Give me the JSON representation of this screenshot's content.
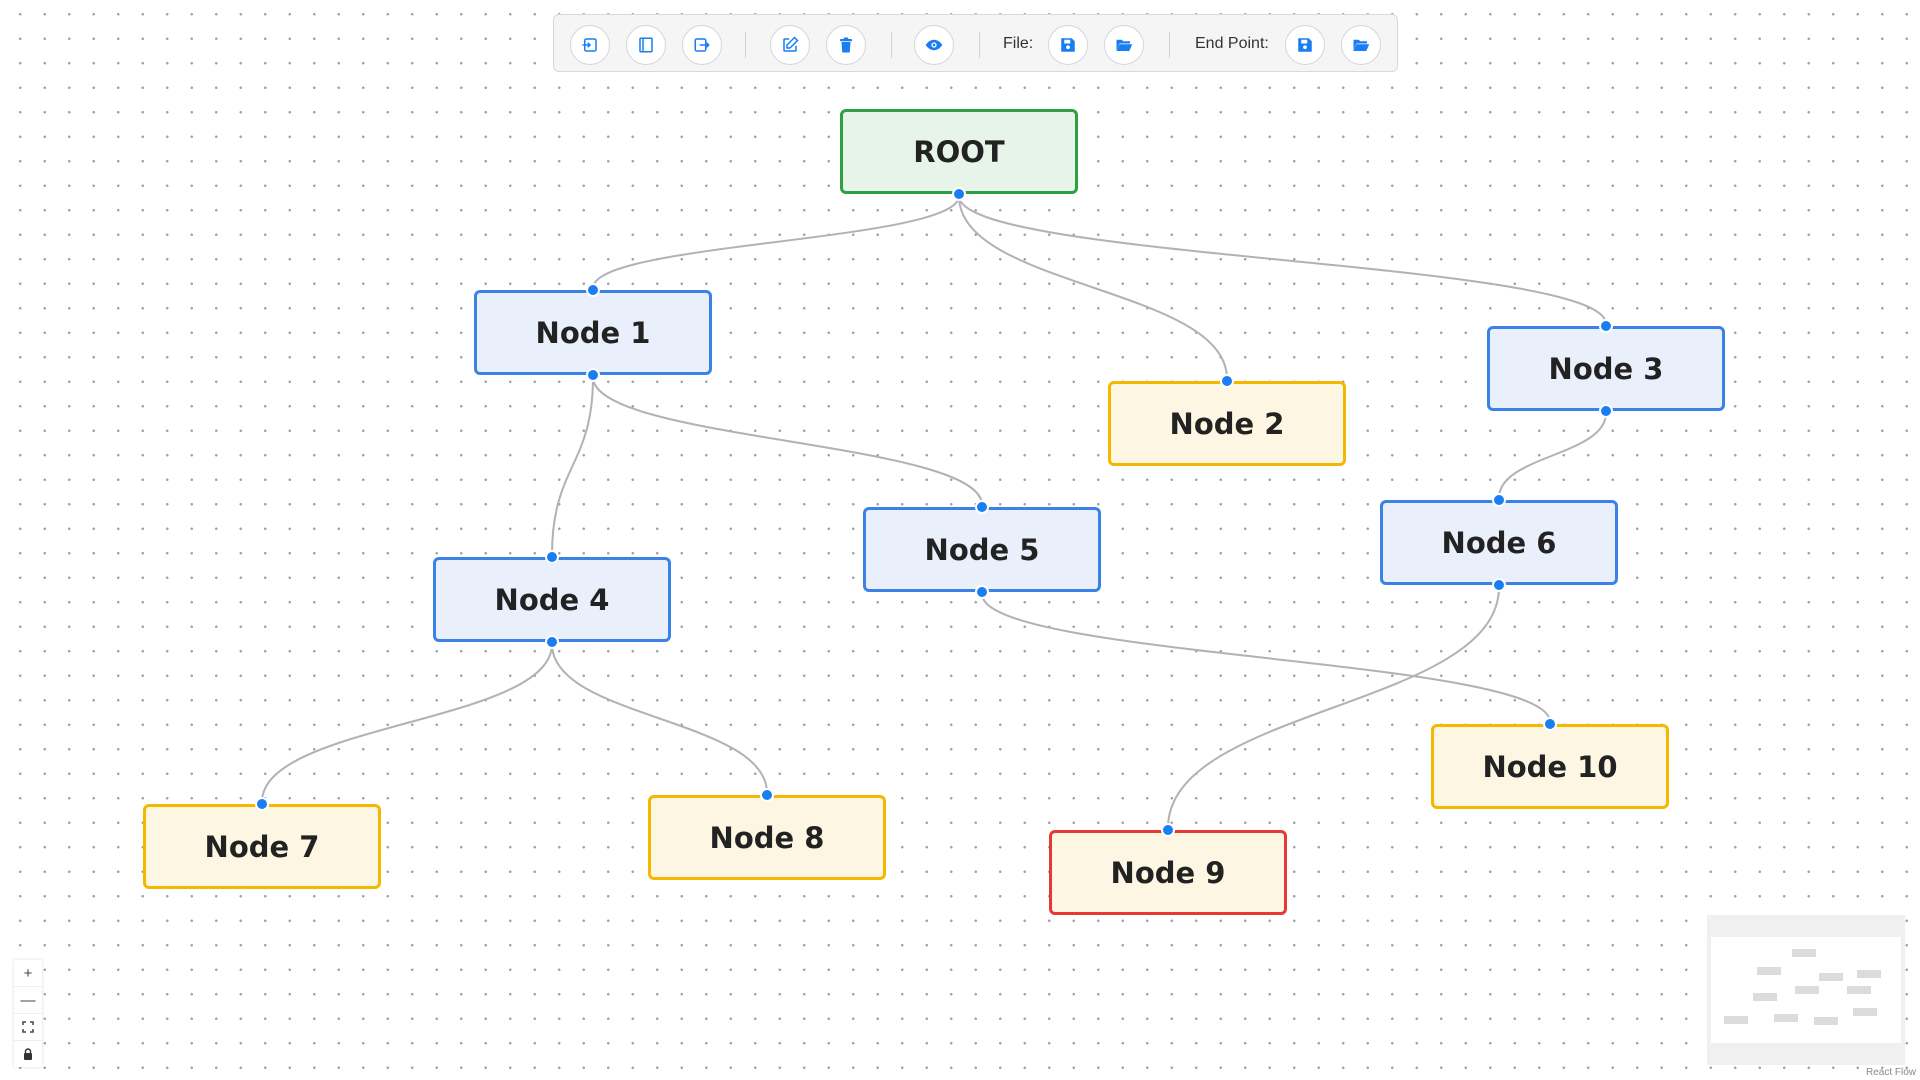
{
  "toolbar": {
    "file_label": "File:",
    "endpoint_label": "End Point:"
  },
  "nodes": [
    {
      "id": "root",
      "label": "ROOT",
      "style": "root"
    },
    {
      "id": "n1",
      "label": "Node 1",
      "style": "blue"
    },
    {
      "id": "n2",
      "label": "Node 2",
      "style": "yellow"
    },
    {
      "id": "n3",
      "label": "Node 3",
      "style": "blue"
    },
    {
      "id": "n4",
      "label": "Node 4",
      "style": "blue"
    },
    {
      "id": "n5",
      "label": "Node 5",
      "style": "blue"
    },
    {
      "id": "n6",
      "label": "Node 6",
      "style": "blue"
    },
    {
      "id": "n7",
      "label": "Node 7",
      "style": "yellow"
    },
    {
      "id": "n8",
      "label": "Node 8",
      "style": "yellow"
    },
    {
      "id": "n9",
      "label": "Node 9",
      "style": "red"
    },
    {
      "id": "n10",
      "label": "Node 10",
      "style": "yellow"
    }
  ],
  "edges": [
    {
      "from": "root",
      "to": "n1"
    },
    {
      "from": "root",
      "to": "n2"
    },
    {
      "from": "root",
      "to": "n3"
    },
    {
      "from": "n1",
      "to": "n4"
    },
    {
      "from": "n1",
      "to": "n5"
    },
    {
      "from": "n3",
      "to": "n6"
    },
    {
      "from": "n4",
      "to": "n7"
    },
    {
      "from": "n4",
      "to": "n8"
    },
    {
      "from": "n5",
      "to": "n10"
    },
    {
      "from": "n6",
      "to": "n9"
    }
  ],
  "colors": {
    "root_border": "#2ea043",
    "blue_border": "#3b82e6",
    "yellow_border": "#f5b800",
    "red_border": "#e53935",
    "handle": "#1a7ef2",
    "edge": "#b1b1b7",
    "icon": "#1a7ef2"
  },
  "attribution": "React Flow"
}
